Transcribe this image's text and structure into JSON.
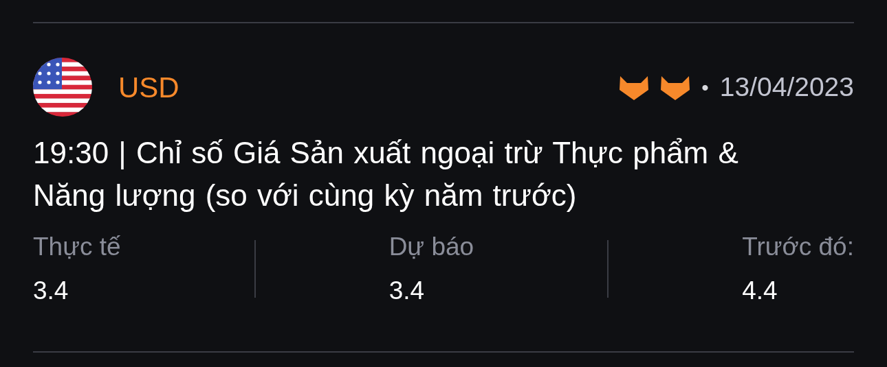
{
  "event": {
    "currency": "USD",
    "importance_icons": [
      {
        "kind": "bull"
      },
      {
        "kind": "bull"
      }
    ],
    "date": "13/04/2023",
    "separator": "•",
    "title": "19:30 | Chỉ số Giá Sản xuất ngoại trừ Thực phẩm & Năng lượng (so với cùng kỳ năm trước)"
  },
  "figures": [
    {
      "label": "Thực tế",
      "value": "3.4"
    },
    {
      "label": "Dự báo",
      "value": "3.4"
    },
    {
      "label": "Trước đó:",
      "value": "4.4"
    }
  ]
}
